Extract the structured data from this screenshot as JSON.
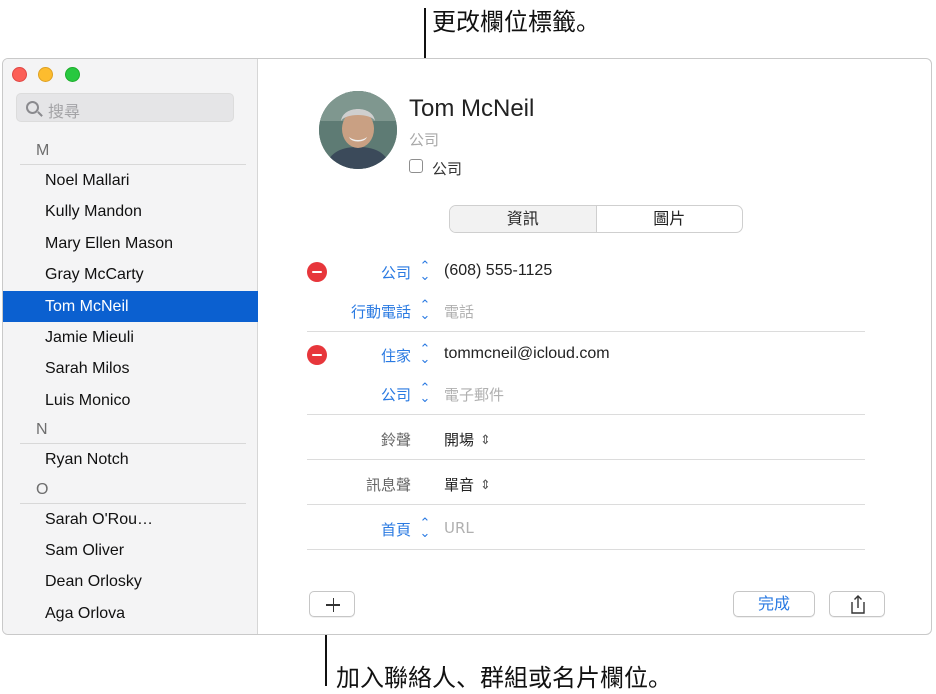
{
  "callouts": {
    "top": "更改欄位標籤。",
    "bottom": "加入聯絡人、群組或名片欄位。"
  },
  "search": {
    "placeholder": "搜尋"
  },
  "sidebar": {
    "sections": [
      {
        "letter": "M",
        "contacts": [
          "Noel Mallari",
          "Kully Mandon",
          "Mary Ellen Mason",
          "Gray McCarty",
          "Tom McNeil",
          "Jamie Mieuli",
          "Sarah Milos",
          "Luis Monico"
        ]
      },
      {
        "letter": "N",
        "contacts": [
          "Ryan Notch"
        ]
      },
      {
        "letter": "O",
        "contacts": [
          "Sarah O'Rou…",
          "Sam Oliver",
          "Dean Orlosky",
          "Aga Orlova"
        ]
      }
    ],
    "selected": "Tom McNeil"
  },
  "card": {
    "name": "Tom  McNeil",
    "company_placeholder": "公司",
    "company_checkbox_label": "公司",
    "tabs": [
      "資訊",
      "圖片"
    ],
    "fields": [
      {
        "label": "公司",
        "value": "(608) 555-1125"
      },
      {
        "label": "行動電話",
        "placeholder": "電話"
      },
      {
        "label": "住家",
        "value": "tommcneil@icloud.com"
      },
      {
        "label": "公司",
        "placeholder": "電子郵件"
      },
      {
        "label": "鈴聲",
        "value": "開場"
      },
      {
        "label": "訊息聲",
        "value": "單音"
      },
      {
        "label": "首頁",
        "placeholder": "URL"
      }
    ]
  },
  "buttons": {
    "done": "完成"
  },
  "colors": {
    "selection": "#0b60d0",
    "accent": "#2a7ae2",
    "delete": "#e7363b"
  }
}
